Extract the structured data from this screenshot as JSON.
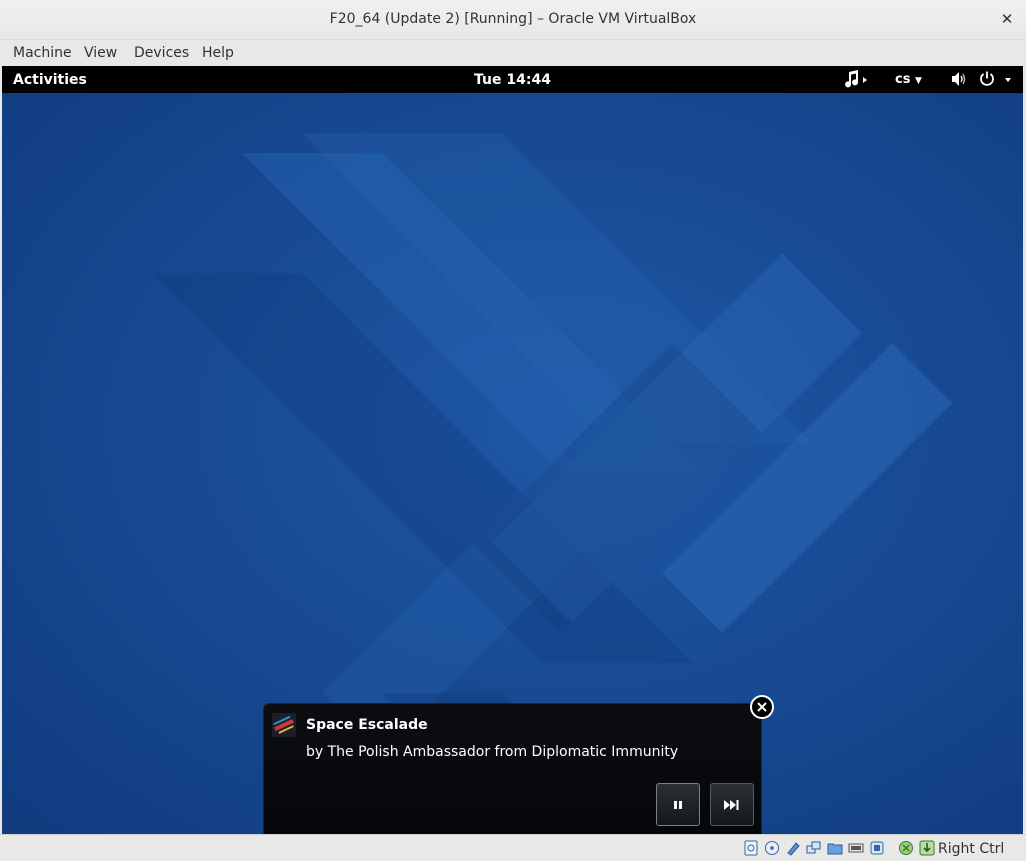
{
  "window": {
    "title": "F20_64 (Update 2) [Running] – Oracle VM VirtualBox"
  },
  "menu": [
    "Machine",
    "View",
    "Devices",
    "Help"
  ],
  "guest": {
    "topbar": {
      "activities": "Activities",
      "clock": "Tue 14:44",
      "keyboard_layout": "cs"
    }
  },
  "notification": {
    "title": "Space Escalade",
    "body": "by The Polish Ambassador from Diplomatic Immunity"
  },
  "statusbar": {
    "host_key": "Right Ctrl",
    "icons": [
      "hard-disk-icon",
      "optical-drive-icon",
      "usb-icon",
      "network-icon",
      "shared-folders-icon",
      "display-icon",
      "video-capture-icon",
      "mouse-integration-icon",
      "keyboard-capture-icon"
    ]
  },
  "colors": {
    "wallpaper": "#1a4d96",
    "topbar": "#000000",
    "notification": "#0b0d10"
  }
}
